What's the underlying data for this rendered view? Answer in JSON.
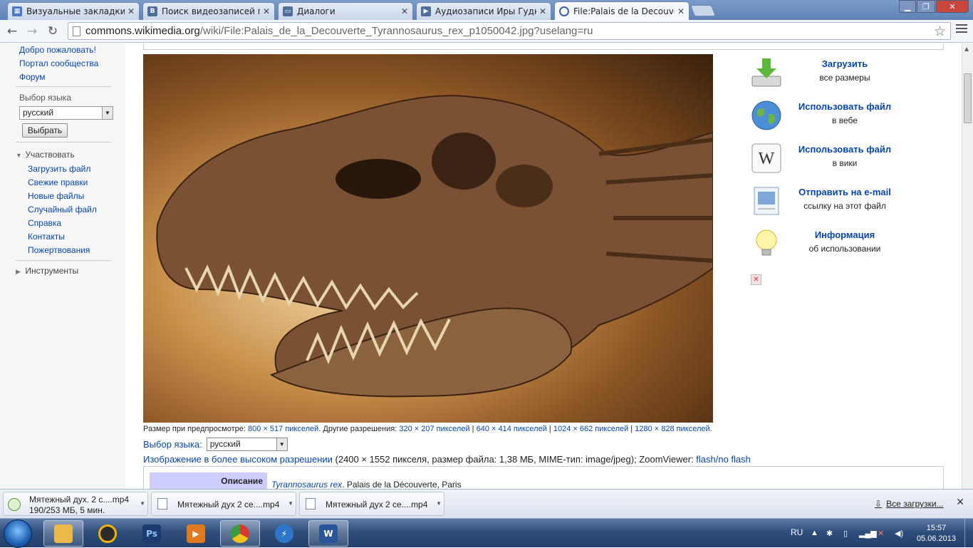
{
  "browser": {
    "tabs": [
      {
        "title": "Визуальные закладки",
        "icon": "grid-icon",
        "active": false
      },
      {
        "title": "Поиск видеозаписей по запросу",
        "icon": "vk-icon",
        "active": false
      },
      {
        "title": "Диалоги",
        "icon": "chat-icon",
        "active": false
      },
      {
        "title": "Аудиозаписи Иры Гудковой",
        "icon": "play-icon",
        "active": false
      },
      {
        "title": "File:Palais de la Decouverte",
        "icon": "wikimedia-icon",
        "active": true
      }
    ],
    "url_domain": "commons.wikimedia.org",
    "url_path": "/wiki/File:Palais_de_la_Decouverte_Tyrannosaurus_rex_p1050042.jpg?uselang=ru",
    "window_controls": [
      "minimize",
      "maximize",
      "close"
    ]
  },
  "sidebar": {
    "top_links": [
      "Добро пожаловать!",
      "Портал сообщества",
      "Форум"
    ],
    "lang_heading": "Выбор языка",
    "lang_value": "русский",
    "lang_button": "Выбрать",
    "participate": {
      "heading": "Участвовать",
      "links": [
        "Загрузить файл",
        "Свежие правки",
        "Новые файлы",
        "Случайный файл",
        "Справка",
        "Контакты",
        "Пожертвования"
      ]
    },
    "tools_heading": "Инструменты"
  },
  "file_page": {
    "preview_meta": {
      "prefix": "Размер при предпросмотре: ",
      "preview_size": "800 × 517 пикселей",
      "other": ". Другие разрешения: ",
      "res": [
        "320 × 207 пикселей",
        "640 × 414 пикселей",
        "1024 × 662 пикселей",
        "1280 × 828 пикселей"
      ],
      "sep": " | ",
      "end": "."
    },
    "lang_label": "Выбор языка:",
    "lang_value": "русский",
    "hires_link": "Изображение в более высоком разрешении",
    "hires_info": " (2400 × 1552 пикселя, размер файла: 1,38 МБ, MIME-тип: image/jpeg); ZoomViewer: ",
    "zoom_link": "flash/no flash",
    "desc_heading": "Описание",
    "desc_link": "Tyrannosaurus rex",
    "desc_rest": ". Palais de la Découverte, Paris"
  },
  "actions": [
    {
      "title": "Загрузить",
      "sub": "все размеры",
      "icon": "download-icon"
    },
    {
      "title": "Использовать файл",
      "sub": "в вебе",
      "icon": "globe-icon"
    },
    {
      "title": "Использовать файл",
      "sub": "в вики",
      "icon": "wikipedia-icon"
    },
    {
      "title": "Отправить на e-mail",
      "sub": "ссылку на этот файл",
      "icon": "email-icon"
    },
    {
      "title": "Информация",
      "sub": "об использовании",
      "icon": "lightbulb-icon"
    }
  ],
  "downloads": {
    "items": [
      {
        "name": "Мятежный дух. 2 с....mp4",
        "status": "190/253 МБ, 5 мин."
      },
      {
        "name": "Мятежный дух 2 се....mp4"
      },
      {
        "name": "Мятежный дух 2 се....mp4"
      }
    ],
    "all_label": "Все загрузки..."
  },
  "taskbar": {
    "apps": [
      {
        "name": "explorer",
        "icon": "folder-icon",
        "color": "#e9b949"
      },
      {
        "name": "aimp",
        "icon": "media-player-icon",
        "color": "#2b2b2b"
      },
      {
        "name": "photoshop",
        "icon": "photoshop-icon",
        "color": "#1c3b6e"
      },
      {
        "name": "video",
        "icon": "video-player-icon",
        "color": "#e07a1f"
      },
      {
        "name": "chrome",
        "icon": "chrome-icon",
        "color": "#3a9b3f"
      },
      {
        "name": "download",
        "icon": "lightning-icon",
        "color": "#2e76c9"
      },
      {
        "name": "word",
        "icon": "word-icon",
        "color": "#2a5699"
      }
    ],
    "tray_lang": "RU",
    "time": "15:57",
    "date": "05.06.2013"
  }
}
